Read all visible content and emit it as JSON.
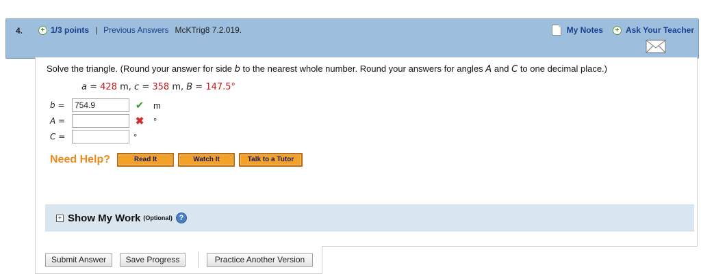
{
  "header": {
    "question_number": "4.",
    "points": "1/3 points",
    "separator": "|",
    "previous_answers": "Previous Answers",
    "question_code": "McKTrig8 7.2.019.",
    "my_notes": "My Notes",
    "ask_teacher": "Ask Your Teacher"
  },
  "question": {
    "prompt_parts": [
      "Solve the triangle. (Round your answer for side ",
      "b",
      " to the nearest whole number. Round your answers for angles ",
      "A",
      " and ",
      "C",
      " to one decimal place.)"
    ],
    "givens": {
      "a_label": "a",
      "a_eq": " = ",
      "a_value": "428",
      "a_unit": " m, ",
      "c_label": "c",
      "c_eq": " = ",
      "c_value": "358",
      "c_unit": " m, ",
      "B_label": "B",
      "B_eq": " = ",
      "B_value": "147.5°"
    }
  },
  "answers": [
    {
      "label": "b",
      "eq": " =",
      "value": "754.9",
      "status": "✔",
      "unit": "m"
    },
    {
      "label": "A",
      "eq": " =",
      "value": "",
      "status": "✖",
      "unit": "°"
    },
    {
      "label": "C",
      "eq": " =",
      "value": "",
      "status": "",
      "unit": "°"
    }
  ],
  "help": {
    "title": "Need Help?",
    "read_it": "Read It",
    "watch_it": "Watch It",
    "tutor": "Talk to a Tutor"
  },
  "show_work": {
    "toggle": "+",
    "label": "Show My Work",
    "optional": "(Optional)",
    "help_icon": "?"
  },
  "footer": {
    "submit": "Submit Answer",
    "save": "Save Progress",
    "practice": "Practice Another Version"
  },
  "colors": {
    "header_bg": "#9dbedc",
    "given_value": "#c8171c",
    "need_help": "#ee8a1a",
    "show_work_bg": "#d9e5ef"
  }
}
